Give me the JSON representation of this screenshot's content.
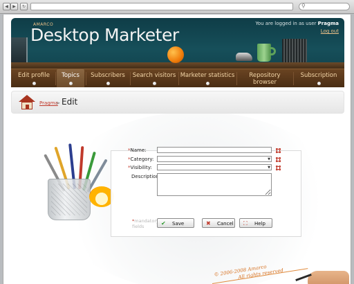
{
  "browser": {
    "back_icon": "back-arrow-icon",
    "forward_icon": "forward-arrow-icon",
    "reload_icon": "reload-icon",
    "search_icon": "search-icon"
  },
  "header": {
    "small_brand": "AMARCO",
    "brand": "Desktop Marketer",
    "login_prefix": "You are logged in as user",
    "username": "Pragma",
    "logout_label": "Log out"
  },
  "nav": {
    "items": [
      {
        "label": "Edit profile"
      },
      {
        "label": "Topics",
        "active": true
      },
      {
        "label": "Subscribers"
      },
      {
        "label": "Search visitors"
      },
      {
        "label": "Marketer statistics"
      },
      {
        "label": "Repository browser"
      },
      {
        "label": "Subscription"
      }
    ]
  },
  "breadcrumb": {
    "home_icon": "home-icon",
    "link": "Pragma",
    "separator": ">",
    "title": "Edit"
  },
  "form": {
    "name_label": "Name:",
    "category_label": "Category:",
    "visibility_label": "Visibility:",
    "description_label": "Description:",
    "required_marker": "*",
    "mandatory_note_line1": "mandatory",
    "mandatory_note_line2": "fields",
    "name_value": "",
    "category_value": "",
    "visibility_value": "",
    "description_value": "",
    "save_label": "Save",
    "cancel_label": "Cancel",
    "help_label": "Help"
  },
  "footer": {
    "line1": "© 2006-2008 Amarco",
    "line2": "All rights reserved"
  },
  "colors": {
    "header_bg": "#164f5a",
    "nav_bg": "#5a3819",
    "nav_text": "#f4d7a8",
    "required": "#c0392b",
    "footer_text": "#d6701f"
  }
}
